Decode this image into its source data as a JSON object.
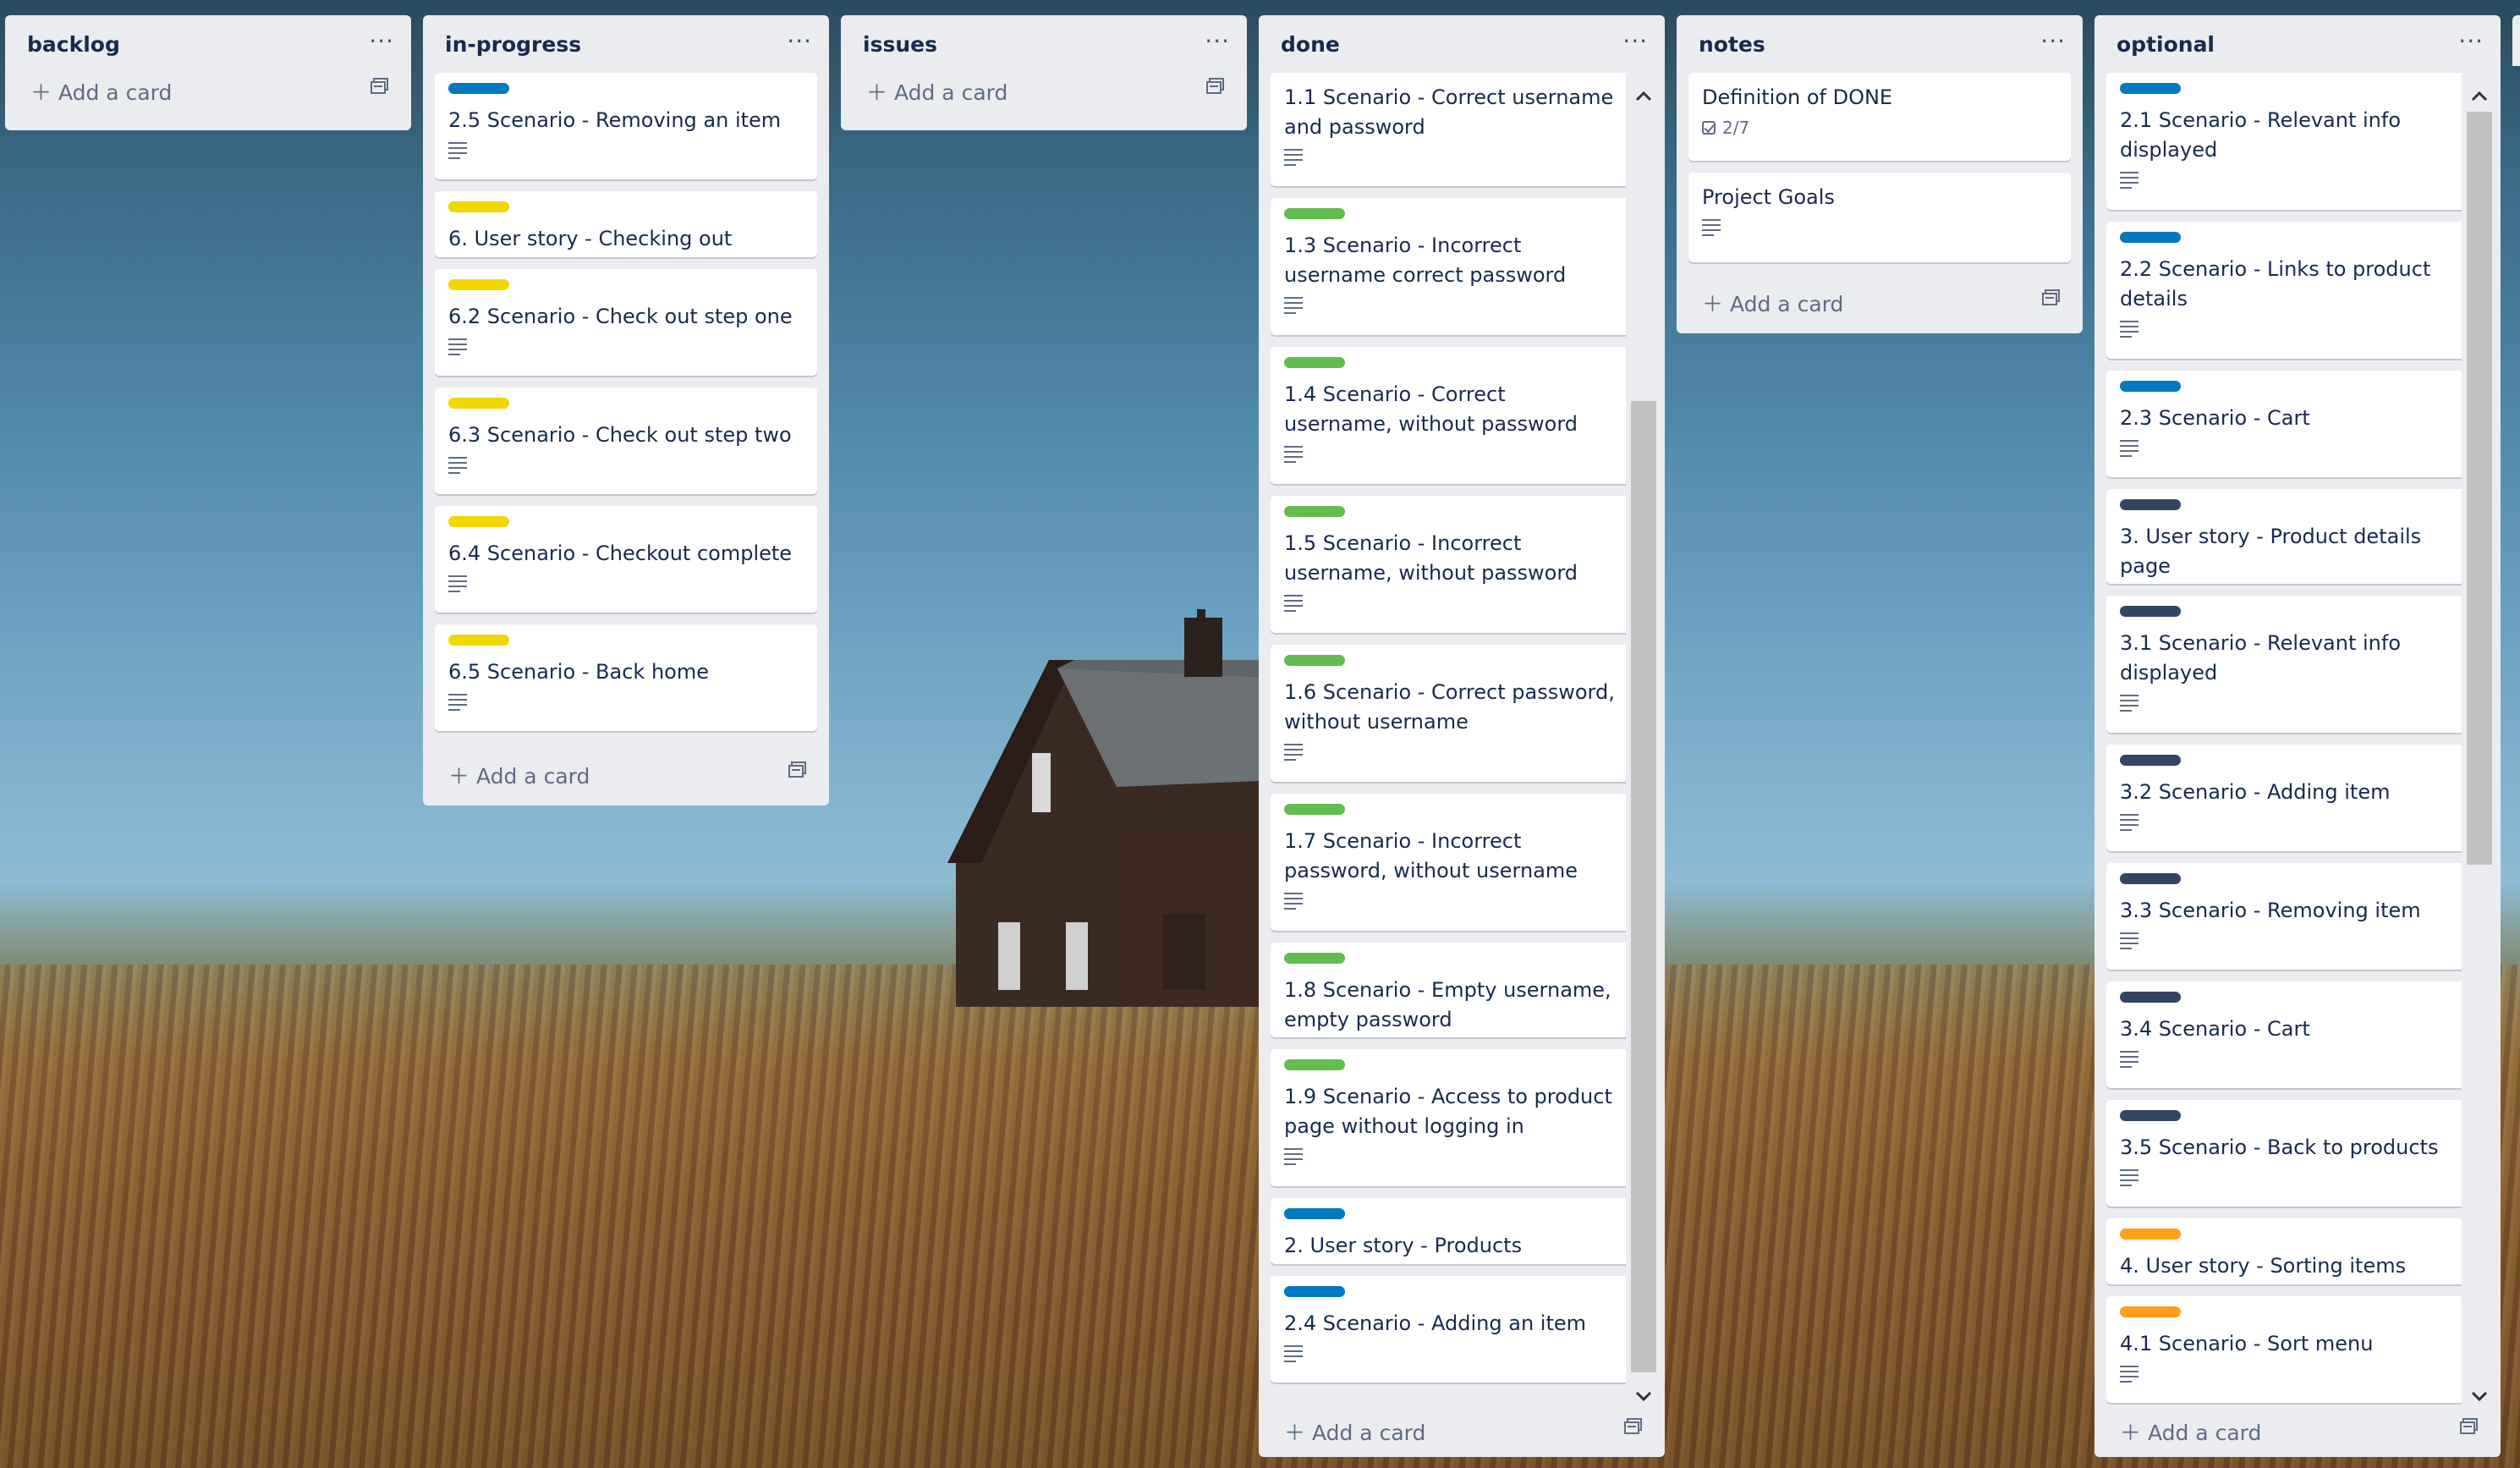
{
  "lists": {
    "backlog": {
      "title": "backlog",
      "menu": "···",
      "add_card": "Add a card"
    },
    "inprogress": {
      "title": "in-progress",
      "menu": "···",
      "add_card": "Add a card",
      "cards": [
        {
          "title": "2.5 Scenario - Removing an item",
          "label_color": "#0079bf"
        },
        {
          "title": "6. User story - Checking out",
          "label_color": "#f2d600"
        },
        {
          "title": "6.2 Scenario - Check out step one",
          "label_color": "#f2d600"
        },
        {
          "title": "6.3 Scenario - Check out step two",
          "label_color": "#f2d600"
        },
        {
          "title": "6.4 Scenario - Checkout complete",
          "label_color": "#f2d600"
        },
        {
          "title": "6.5 Scenario - Back home",
          "label_color": "#f2d600"
        }
      ]
    },
    "issues": {
      "title": "issues",
      "menu": "···",
      "add_card": "Add a card"
    },
    "done": {
      "title": "done",
      "menu": "···",
      "add_card": "Add a card",
      "cards": [
        {
          "title": "1.1 Scenario - Correct username and password"
        },
        {
          "title": "1.3 Scenario - Incorrect username correct password",
          "label_color": "#61bd4f"
        },
        {
          "title": "1.4 Scenario - Correct username, without password",
          "label_color": "#61bd4f"
        },
        {
          "title": "1.5 Scenario - Incorrect username, without password",
          "label_color": "#61bd4f"
        },
        {
          "title": "1.6 Scenario - Correct password, without username",
          "label_color": "#61bd4f"
        },
        {
          "title": "1.7 Scenario - Incorrect password, without username",
          "label_color": "#61bd4f"
        },
        {
          "title": "1.8 Scenario - Empty username, empty password",
          "label_color": "#61bd4f"
        },
        {
          "title": "1.9 Scenario - Access to product page without logging in",
          "label_color": "#61bd4f"
        },
        {
          "title": "2. User story - Products",
          "label_color": "#0079bf"
        },
        {
          "title": "2.4 Scenario - Adding an item",
          "label_color": "#0079bf"
        }
      ]
    },
    "notes": {
      "title": "notes",
      "menu": "···",
      "add_card": "Add a card",
      "cards": [
        {
          "title": "Definition of DONE",
          "checklist": "2/7"
        },
        {
          "title": "Project Goals"
        }
      ]
    },
    "optional": {
      "title": "optional",
      "menu": "···",
      "add_card": "Add a card",
      "cards": [
        {
          "title": "2.1 Scenario - Relevant info displayed",
          "label_color": "#0079bf"
        },
        {
          "title": "2.2 Scenario - Links to product details",
          "label_color": "#0079bf"
        },
        {
          "title": "2.3 Scenario - Cart",
          "label_color": "#0079bf"
        },
        {
          "title": "3. User story - Product details page",
          "label_color": "#344563"
        },
        {
          "title": "3.1 Scenario - Relevant info displayed",
          "label_color": "#344563"
        },
        {
          "title": "3.2 Scenario - Adding item",
          "label_color": "#344563"
        },
        {
          "title": "3.3 Scenario - Removing item",
          "label_color": "#344563"
        },
        {
          "title": "3.4 Scenario - Cart",
          "label_color": "#344563"
        },
        {
          "title": "3.5 Scenario - Back to products",
          "label_color": "#344563"
        },
        {
          "title": "4. User story - Sorting items",
          "label_color": "#ff9f1a"
        },
        {
          "title": "4.1 Scenario - Sort menu",
          "label_color": "#ff9f1a"
        }
      ]
    }
  }
}
